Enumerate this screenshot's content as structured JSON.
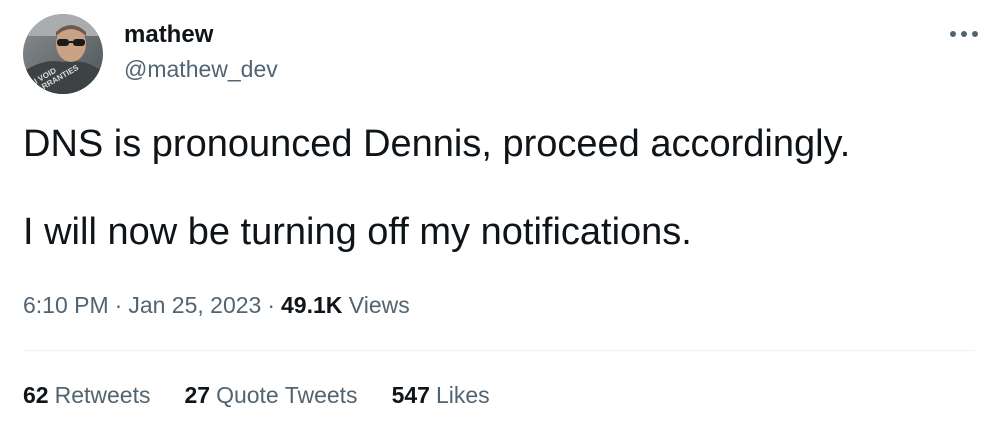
{
  "user": {
    "display_name": "mathew",
    "handle": "@mathew_dev",
    "avatar_text_line1": "I VOID",
    "avatar_text_line2": "WARRANTIES"
  },
  "tweet": {
    "line1": "DNS is pronounced Dennis, proceed accordingly.",
    "line2": "I will now be turning off my notifications."
  },
  "meta": {
    "time": "6:10 PM",
    "separator": "·",
    "date": "Jan 25, 2023",
    "views_count": "49.1K",
    "views_label": "Views"
  },
  "stats": [
    {
      "count": "62",
      "label": "Retweets"
    },
    {
      "count": "27",
      "label": "Quote Tweets"
    },
    {
      "count": "547",
      "label": "Likes"
    }
  ],
  "icons": {
    "more": "more-horizontal-icon"
  },
  "colors": {
    "primary_text": "#0f1419",
    "secondary_text": "#536471",
    "divider": "#eff3f4"
  }
}
